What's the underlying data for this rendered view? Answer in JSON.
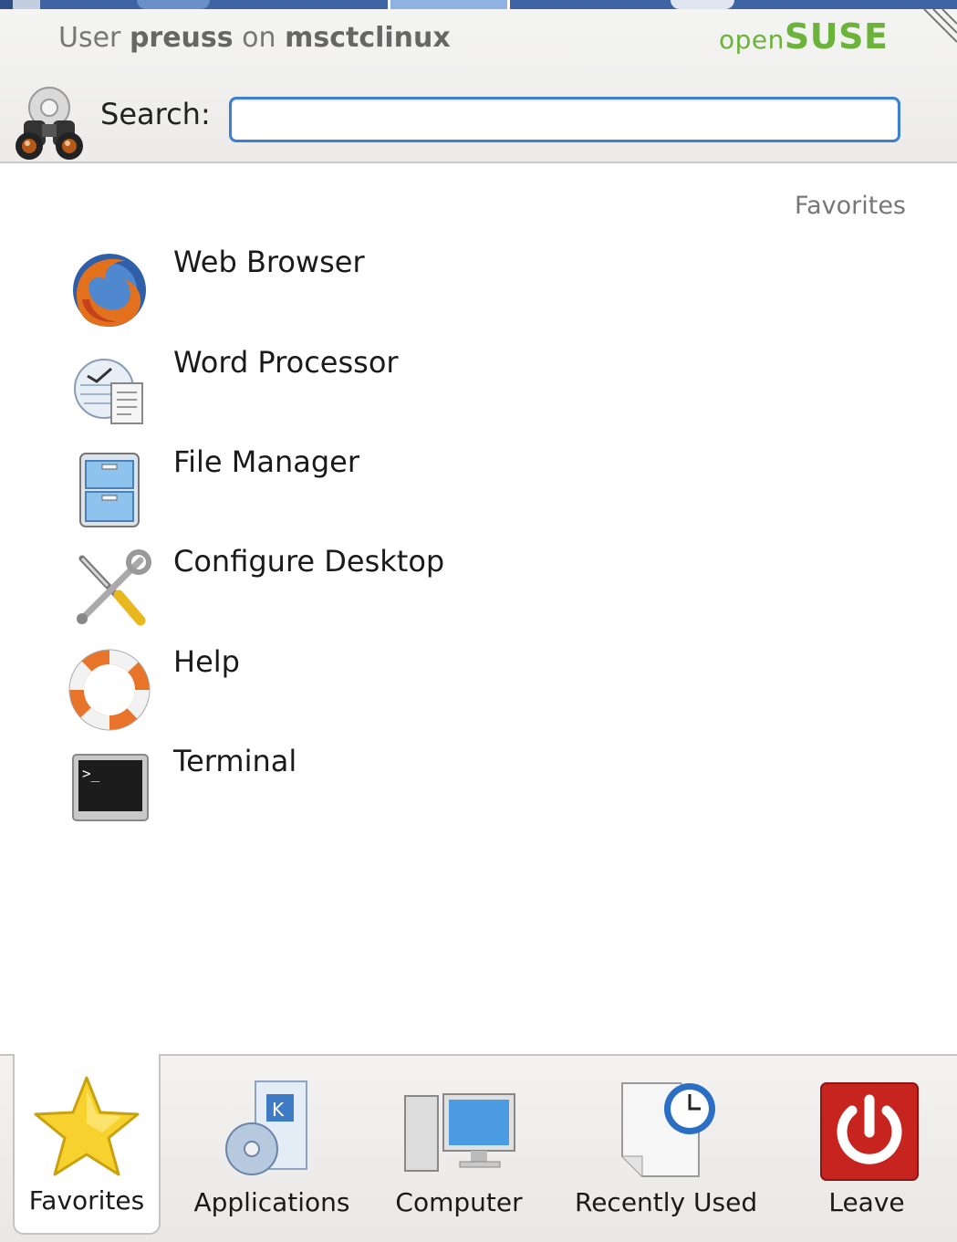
{
  "header": {
    "user_prefix": "User",
    "username": "preuss",
    "on_text": "on",
    "hostname": "msctclinux",
    "brand_open": "open",
    "brand_suse": "SUSE"
  },
  "search": {
    "label": "Search:",
    "value": "",
    "placeholder": ""
  },
  "section": {
    "title": "Favorites"
  },
  "favorites": [
    {
      "label": "Web Browser",
      "icon": "firefox-icon"
    },
    {
      "label": "Word Processor",
      "icon": "word-processor-icon"
    },
    {
      "label": "File Manager",
      "icon": "file-manager-icon"
    },
    {
      "label": "Configure Desktop",
      "icon": "configure-desktop-icon"
    },
    {
      "label": "Help",
      "icon": "help-lifebuoy-icon"
    },
    {
      "label": "Terminal",
      "icon": "terminal-icon"
    }
  ],
  "tabs": [
    {
      "label": "Favorites",
      "icon": "star-icon",
      "active": true
    },
    {
      "label": "Applications",
      "icon": "applications-icon",
      "active": false
    },
    {
      "label": "Computer",
      "icon": "computer-icon",
      "active": false
    },
    {
      "label": "Recently Used",
      "icon": "clock-document-icon",
      "active": false
    },
    {
      "label": "Leave",
      "icon": "power-icon",
      "active": false
    }
  ],
  "colors": {
    "accent": "#3f7fd1",
    "brand_green": "#6bb33a",
    "leave_red": "#c8241f"
  }
}
